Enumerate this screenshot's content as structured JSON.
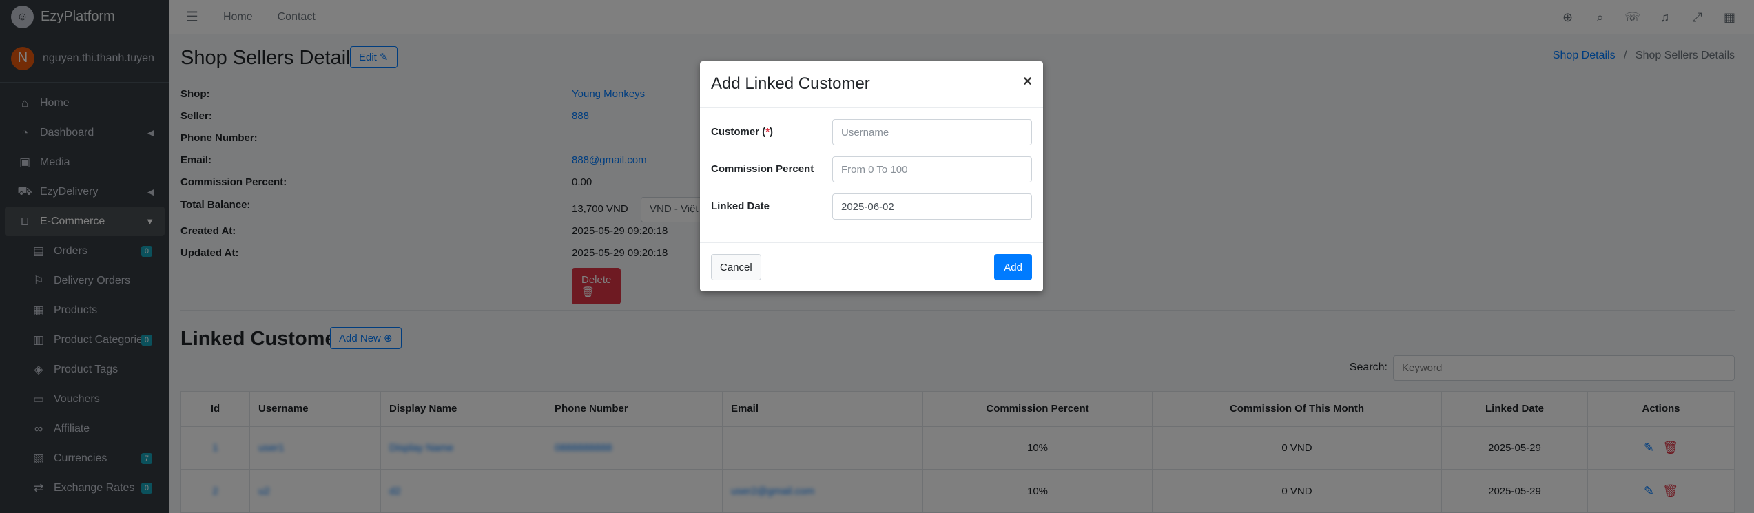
{
  "brand": {
    "name": "EzyPlatform",
    "logo_icon": "logo-icon"
  },
  "user": {
    "initial": "N",
    "name": "nguyen.thi.thanh.tuyen"
  },
  "sidebar": {
    "items": [
      {
        "label": "Home",
        "icon": "home-icon"
      },
      {
        "label": "Dashboard",
        "icon": "dashboard-icon"
      },
      {
        "label": "Media",
        "icon": "media-icon"
      },
      {
        "label": "EzyDelivery",
        "icon": "truck-icon"
      },
      {
        "label": "E-Commerce",
        "icon": "basket-icon"
      },
      {
        "label": "Orders",
        "icon": "orders-icon",
        "badge": "0"
      },
      {
        "label": "Delivery Orders",
        "icon": "delivery-icon"
      },
      {
        "label": "Products",
        "icon": "products-icon"
      },
      {
        "label": "Product Categories",
        "icon": "categories-icon",
        "badge": "0"
      },
      {
        "label": "Product Tags",
        "icon": "tags-icon"
      },
      {
        "label": "Vouchers",
        "icon": "voucher-icon"
      },
      {
        "label": "Affiliate",
        "icon": "link-icon"
      },
      {
        "label": "Currencies",
        "icon": "currency-icon",
        "badge": "7"
      },
      {
        "label": "Exchange Rates",
        "icon": "exchange-icon",
        "badge": "0"
      }
    ]
  },
  "topbar": {
    "links": [
      "Home",
      "Contact"
    ]
  },
  "page": {
    "title": "Shop Sellers Details",
    "edit_label": "Edit",
    "breadcrumb": {
      "parent": "Shop Details",
      "separator": "/",
      "current": "Shop Sellers Details"
    }
  },
  "details": {
    "shop_label": "Shop:",
    "shop_value": "Young Monkeys",
    "seller_label": "Seller:",
    "seller_value": "888",
    "phone_label": "Phone Number:",
    "phone_value": "",
    "email_label": "Email:",
    "email_value": "888@gmail.com",
    "commission_label": "Commission Percent:",
    "commission_value": "0.00",
    "balance_label": "Total Balance:",
    "balance_value": "13,700 VND",
    "currency_selected": "VND - Việt Nam",
    "created_label": "Created At:",
    "created_value": "2025-05-29 09:20:18",
    "updated_label": "Updated At:",
    "updated_value": "2025-05-29 09:20:18",
    "delete_label": "Delete"
  },
  "linked": {
    "title": "Linked Customers",
    "add_new_label": "Add New",
    "search_label": "Search:",
    "search_placeholder": "Keyword",
    "columns": [
      "Id",
      "Username",
      "Display Name",
      "Phone Number",
      "Email",
      "Commission Percent",
      "Commission Of This Month",
      "Linked Date",
      "Actions"
    ],
    "rows": [
      {
        "id": "1",
        "username": "user1",
        "display_name": "Display Name",
        "phone": "0888888888",
        "email": "",
        "commission": "10%",
        "month": "0 VND",
        "date": "2025-05-29"
      },
      {
        "id": "2",
        "username": "u2",
        "display_name": "d2",
        "phone": "",
        "email": "user2@gmail.com",
        "commission": "10%",
        "month": "0 VND",
        "date": "2025-05-29"
      }
    ]
  },
  "modal": {
    "title": "Add Linked Customer",
    "close": "×",
    "customer_label": "Customer (",
    "customer_req": "*",
    "customer_label_end": ")",
    "customer_placeholder": "Username",
    "commission_label": "Commission Percent",
    "commission_placeholder": "From 0 To 100",
    "date_label": "Linked Date",
    "date_value": "2025-06-02",
    "cancel_label": "Cancel",
    "add_label": "Add"
  }
}
